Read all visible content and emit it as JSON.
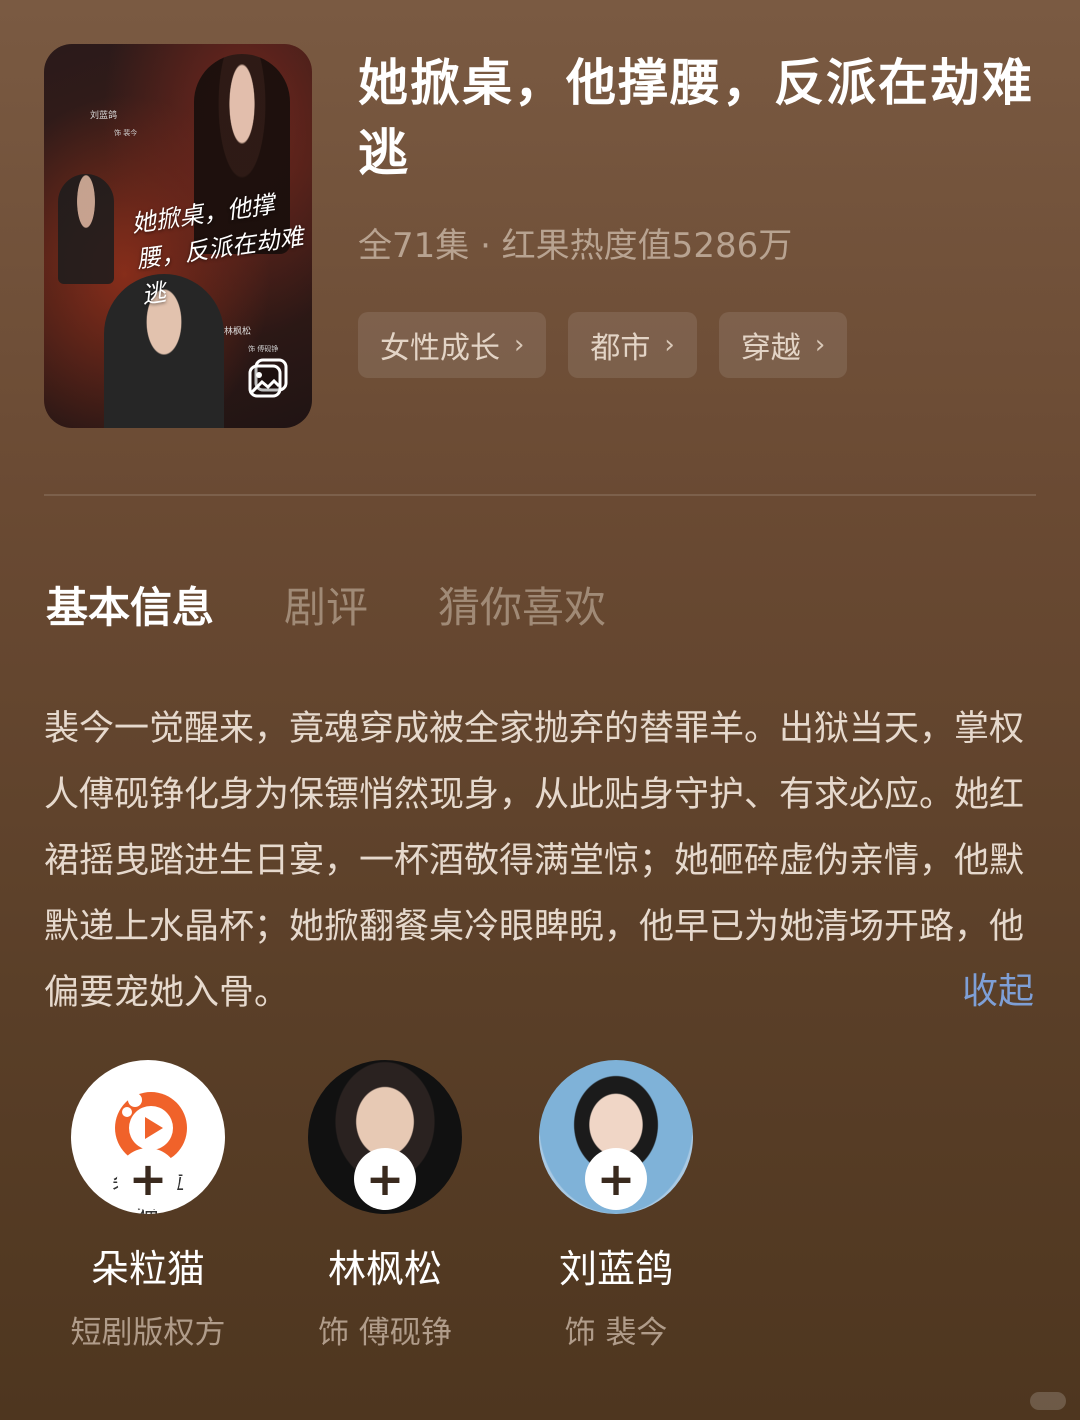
{
  "poster": {
    "title_art": "她掀桌，他撑腰，反派在劫难逃",
    "actor_top_name": "刘蓝鸽",
    "actor_top_role": "饰 裴今",
    "actor_bottom_name": "林枫松",
    "actor_bottom_role": "饰 傅砚铮",
    "cover_icon": "image-gallery-icon"
  },
  "drama": {
    "title": "她掀桌，他撑腰，反派在劫难逃",
    "meta": "全71集 · 红果热度值5286万"
  },
  "tags": [
    {
      "label": "女性成长"
    },
    {
      "label": "都市"
    },
    {
      "label": "穿越"
    }
  ],
  "tabs": [
    {
      "label": "基本信息",
      "active": true
    },
    {
      "label": "剧评",
      "active": false
    },
    {
      "label": "猜你喜欢",
      "active": false
    }
  ],
  "synopsis": "裴今一觉醒来，竟魂穿成被全家抛弃的替罪羊。出狱当天，掌权人傅砚铮化身为保镖悄然现身，从此贴身守护、有求必应。她红裙摇曳踏进生日宴，一杯酒敬得满堂惊；她砸碎虚伪亲情，他默默递上水晶杯；她掀翻餐桌冷眼睥睨，他早已为她清场开路，他偏要宠她入骨。",
  "collapse_label": "收起",
  "cast": [
    {
      "name": "朵粒猫",
      "role": "短剧版权方",
      "logo_text": "朵粒猫"
    },
    {
      "name": "林枫松",
      "role": "饰 傅砚铮"
    },
    {
      "name": "刘蓝鸽",
      "role": "饰 裴今"
    }
  ],
  "colors": {
    "accent_link": "#7e9fd6",
    "logo_orange": "#f0622a"
  }
}
